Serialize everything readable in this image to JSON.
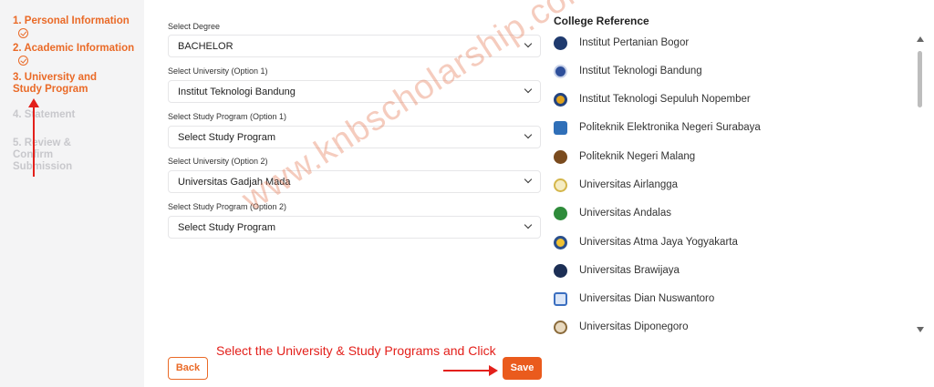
{
  "sidebar": {
    "steps": [
      {
        "label": "1. Personal Information",
        "state": "done"
      },
      {
        "label": "2. Academic Information",
        "state": "done"
      },
      {
        "label": "3. University and Study Program",
        "state": "active"
      },
      {
        "label": "4. Statement",
        "state": "todo"
      },
      {
        "label": "5. Review & Confirm Submission",
        "state": "todo"
      }
    ]
  },
  "form": {
    "fields": [
      {
        "label": "Select Degree",
        "value": "BACHELOR"
      },
      {
        "label": "Select University (Option 1)",
        "value": "Institut Teknologi Bandung"
      },
      {
        "label": "Select Study Program (Option 1)",
        "value": "Select Study Program"
      },
      {
        "label": "Select University (Option 2)",
        "value": "Universitas Gadjah Mada"
      },
      {
        "label": "Select Study Program (Option 2)",
        "value": "Select Study Program"
      }
    ],
    "back_label": "Back",
    "save_label": "Save"
  },
  "reference": {
    "title": "College Reference",
    "items": [
      {
        "name": "Institut Pertanian Bogor",
        "logo_color": "#1f3a6e"
      },
      {
        "name": "Institut Teknologi Bandung",
        "logo_color": "#2e4f9a"
      },
      {
        "name": "Institut Teknologi Sepuluh Nopember",
        "logo_color": "#e0a21b"
      },
      {
        "name": "Politeknik Elektronika Negeri Surabaya",
        "logo_color": "#2f6fb8"
      },
      {
        "name": "Politeknik Negeri Malang",
        "logo_color": "#7a4b1e"
      },
      {
        "name": "Universitas Airlangga",
        "logo_color": "#d4b64a"
      },
      {
        "name": "Universitas Andalas",
        "logo_color": "#2e8b3a"
      },
      {
        "name": "Universitas Atma Jaya Yogyakarta",
        "logo_color": "#2a4f8c"
      },
      {
        "name": "Universitas Brawijaya",
        "logo_color": "#1c2f55"
      },
      {
        "name": "Universitas Dian Nuswantoro",
        "logo_color": "#3b6fc0"
      },
      {
        "name": "Universitas Diponegoro",
        "logo_color": "#8a6a3a"
      }
    ]
  },
  "annotation": {
    "instruction": "Select the University & Study Programs and Click",
    "watermark": "www.knbscholarship.com"
  },
  "colors": {
    "accent": "#ea6a27",
    "annotation_red": "#e3201b"
  }
}
